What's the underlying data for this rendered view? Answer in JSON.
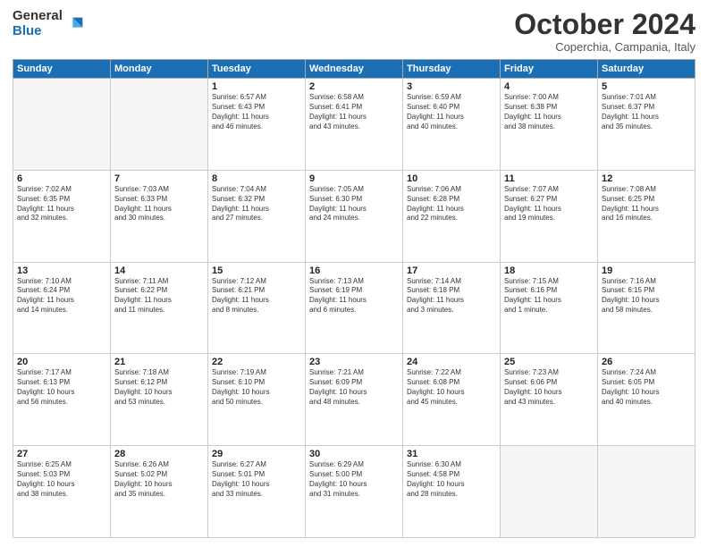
{
  "logo": {
    "general": "General",
    "blue": "Blue"
  },
  "title": "October 2024",
  "location": "Coperchia, Campania, Italy",
  "headers": [
    "Sunday",
    "Monday",
    "Tuesday",
    "Wednesday",
    "Thursday",
    "Friday",
    "Saturday"
  ],
  "weeks": [
    [
      {
        "day": "",
        "info": ""
      },
      {
        "day": "",
        "info": ""
      },
      {
        "day": "1",
        "info": "Sunrise: 6:57 AM\nSunset: 6:43 PM\nDaylight: 11 hours\nand 46 minutes."
      },
      {
        "day": "2",
        "info": "Sunrise: 6:58 AM\nSunset: 6:41 PM\nDaylight: 11 hours\nand 43 minutes."
      },
      {
        "day": "3",
        "info": "Sunrise: 6:59 AM\nSunset: 6:40 PM\nDaylight: 11 hours\nand 40 minutes."
      },
      {
        "day": "4",
        "info": "Sunrise: 7:00 AM\nSunset: 6:38 PM\nDaylight: 11 hours\nand 38 minutes."
      },
      {
        "day": "5",
        "info": "Sunrise: 7:01 AM\nSunset: 6:37 PM\nDaylight: 11 hours\nand 35 minutes."
      }
    ],
    [
      {
        "day": "6",
        "info": "Sunrise: 7:02 AM\nSunset: 6:35 PM\nDaylight: 11 hours\nand 32 minutes."
      },
      {
        "day": "7",
        "info": "Sunrise: 7:03 AM\nSunset: 6:33 PM\nDaylight: 11 hours\nand 30 minutes."
      },
      {
        "day": "8",
        "info": "Sunrise: 7:04 AM\nSunset: 6:32 PM\nDaylight: 11 hours\nand 27 minutes."
      },
      {
        "day": "9",
        "info": "Sunrise: 7:05 AM\nSunset: 6:30 PM\nDaylight: 11 hours\nand 24 minutes."
      },
      {
        "day": "10",
        "info": "Sunrise: 7:06 AM\nSunset: 6:28 PM\nDaylight: 11 hours\nand 22 minutes."
      },
      {
        "day": "11",
        "info": "Sunrise: 7:07 AM\nSunset: 6:27 PM\nDaylight: 11 hours\nand 19 minutes."
      },
      {
        "day": "12",
        "info": "Sunrise: 7:08 AM\nSunset: 6:25 PM\nDaylight: 11 hours\nand 16 minutes."
      }
    ],
    [
      {
        "day": "13",
        "info": "Sunrise: 7:10 AM\nSunset: 6:24 PM\nDaylight: 11 hours\nand 14 minutes."
      },
      {
        "day": "14",
        "info": "Sunrise: 7:11 AM\nSunset: 6:22 PM\nDaylight: 11 hours\nand 11 minutes."
      },
      {
        "day": "15",
        "info": "Sunrise: 7:12 AM\nSunset: 6:21 PM\nDaylight: 11 hours\nand 8 minutes."
      },
      {
        "day": "16",
        "info": "Sunrise: 7:13 AM\nSunset: 6:19 PM\nDaylight: 11 hours\nand 6 minutes."
      },
      {
        "day": "17",
        "info": "Sunrise: 7:14 AM\nSunset: 6:18 PM\nDaylight: 11 hours\nand 3 minutes."
      },
      {
        "day": "18",
        "info": "Sunrise: 7:15 AM\nSunset: 6:16 PM\nDaylight: 11 hours\nand 1 minute."
      },
      {
        "day": "19",
        "info": "Sunrise: 7:16 AM\nSunset: 6:15 PM\nDaylight: 10 hours\nand 58 minutes."
      }
    ],
    [
      {
        "day": "20",
        "info": "Sunrise: 7:17 AM\nSunset: 6:13 PM\nDaylight: 10 hours\nand 56 minutes."
      },
      {
        "day": "21",
        "info": "Sunrise: 7:18 AM\nSunset: 6:12 PM\nDaylight: 10 hours\nand 53 minutes."
      },
      {
        "day": "22",
        "info": "Sunrise: 7:19 AM\nSunset: 6:10 PM\nDaylight: 10 hours\nand 50 minutes."
      },
      {
        "day": "23",
        "info": "Sunrise: 7:21 AM\nSunset: 6:09 PM\nDaylight: 10 hours\nand 48 minutes."
      },
      {
        "day": "24",
        "info": "Sunrise: 7:22 AM\nSunset: 6:08 PM\nDaylight: 10 hours\nand 45 minutes."
      },
      {
        "day": "25",
        "info": "Sunrise: 7:23 AM\nSunset: 6:06 PM\nDaylight: 10 hours\nand 43 minutes."
      },
      {
        "day": "26",
        "info": "Sunrise: 7:24 AM\nSunset: 6:05 PM\nDaylight: 10 hours\nand 40 minutes."
      }
    ],
    [
      {
        "day": "27",
        "info": "Sunrise: 6:25 AM\nSunset: 5:03 PM\nDaylight: 10 hours\nand 38 minutes."
      },
      {
        "day": "28",
        "info": "Sunrise: 6:26 AM\nSunset: 5:02 PM\nDaylight: 10 hours\nand 35 minutes."
      },
      {
        "day": "29",
        "info": "Sunrise: 6:27 AM\nSunset: 5:01 PM\nDaylight: 10 hours\nand 33 minutes."
      },
      {
        "day": "30",
        "info": "Sunrise: 6:29 AM\nSunset: 5:00 PM\nDaylight: 10 hours\nand 31 minutes."
      },
      {
        "day": "31",
        "info": "Sunrise: 6:30 AM\nSunset: 4:58 PM\nDaylight: 10 hours\nand 28 minutes."
      },
      {
        "day": "",
        "info": ""
      },
      {
        "day": "",
        "info": ""
      }
    ]
  ]
}
